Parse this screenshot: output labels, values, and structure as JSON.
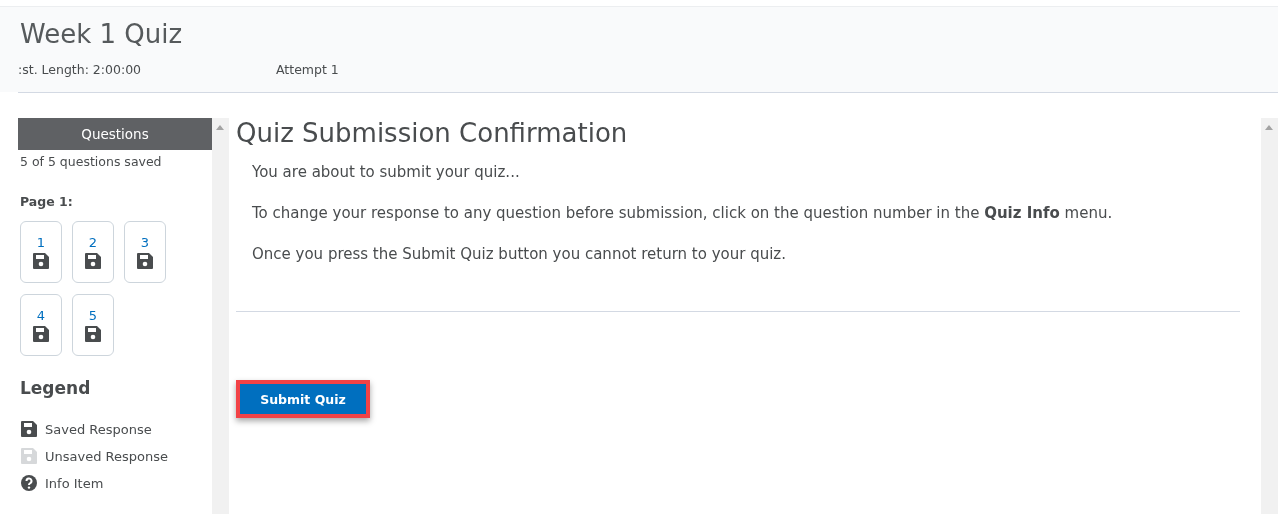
{
  "header": {
    "title": "Week 1 Quiz",
    "est_length": ":st. Length: 2:00:00",
    "attempt": "Attempt 1"
  },
  "sidebar": {
    "heading": "Questions",
    "saved_count": "5 of 5 questions saved",
    "page_label": "Page 1:",
    "questions": [
      {
        "number": "1",
        "saved": true
      },
      {
        "number": "2",
        "saved": true
      },
      {
        "number": "3",
        "saved": true
      },
      {
        "number": "4",
        "saved": true
      },
      {
        "number": "5",
        "saved": true
      }
    ],
    "legend_title": "Legend",
    "legend": [
      {
        "kind": "saved",
        "label": "Saved Response"
      },
      {
        "kind": "unsaved",
        "label": "Unsaved Response"
      },
      {
        "kind": "info",
        "label": "Info Item"
      }
    ]
  },
  "main": {
    "title": "Quiz Submission Confirmation",
    "paragraphs": [
      "You are about to submit your quiz...",
      "To change your response to any question before submission, click on the question number in the **Quiz Info** menu.",
      "Once you press the Submit Quiz button you cannot return to your quiz."
    ],
    "submit": {
      "label": "Submit Quiz",
      "highlighted": true
    }
  }
}
